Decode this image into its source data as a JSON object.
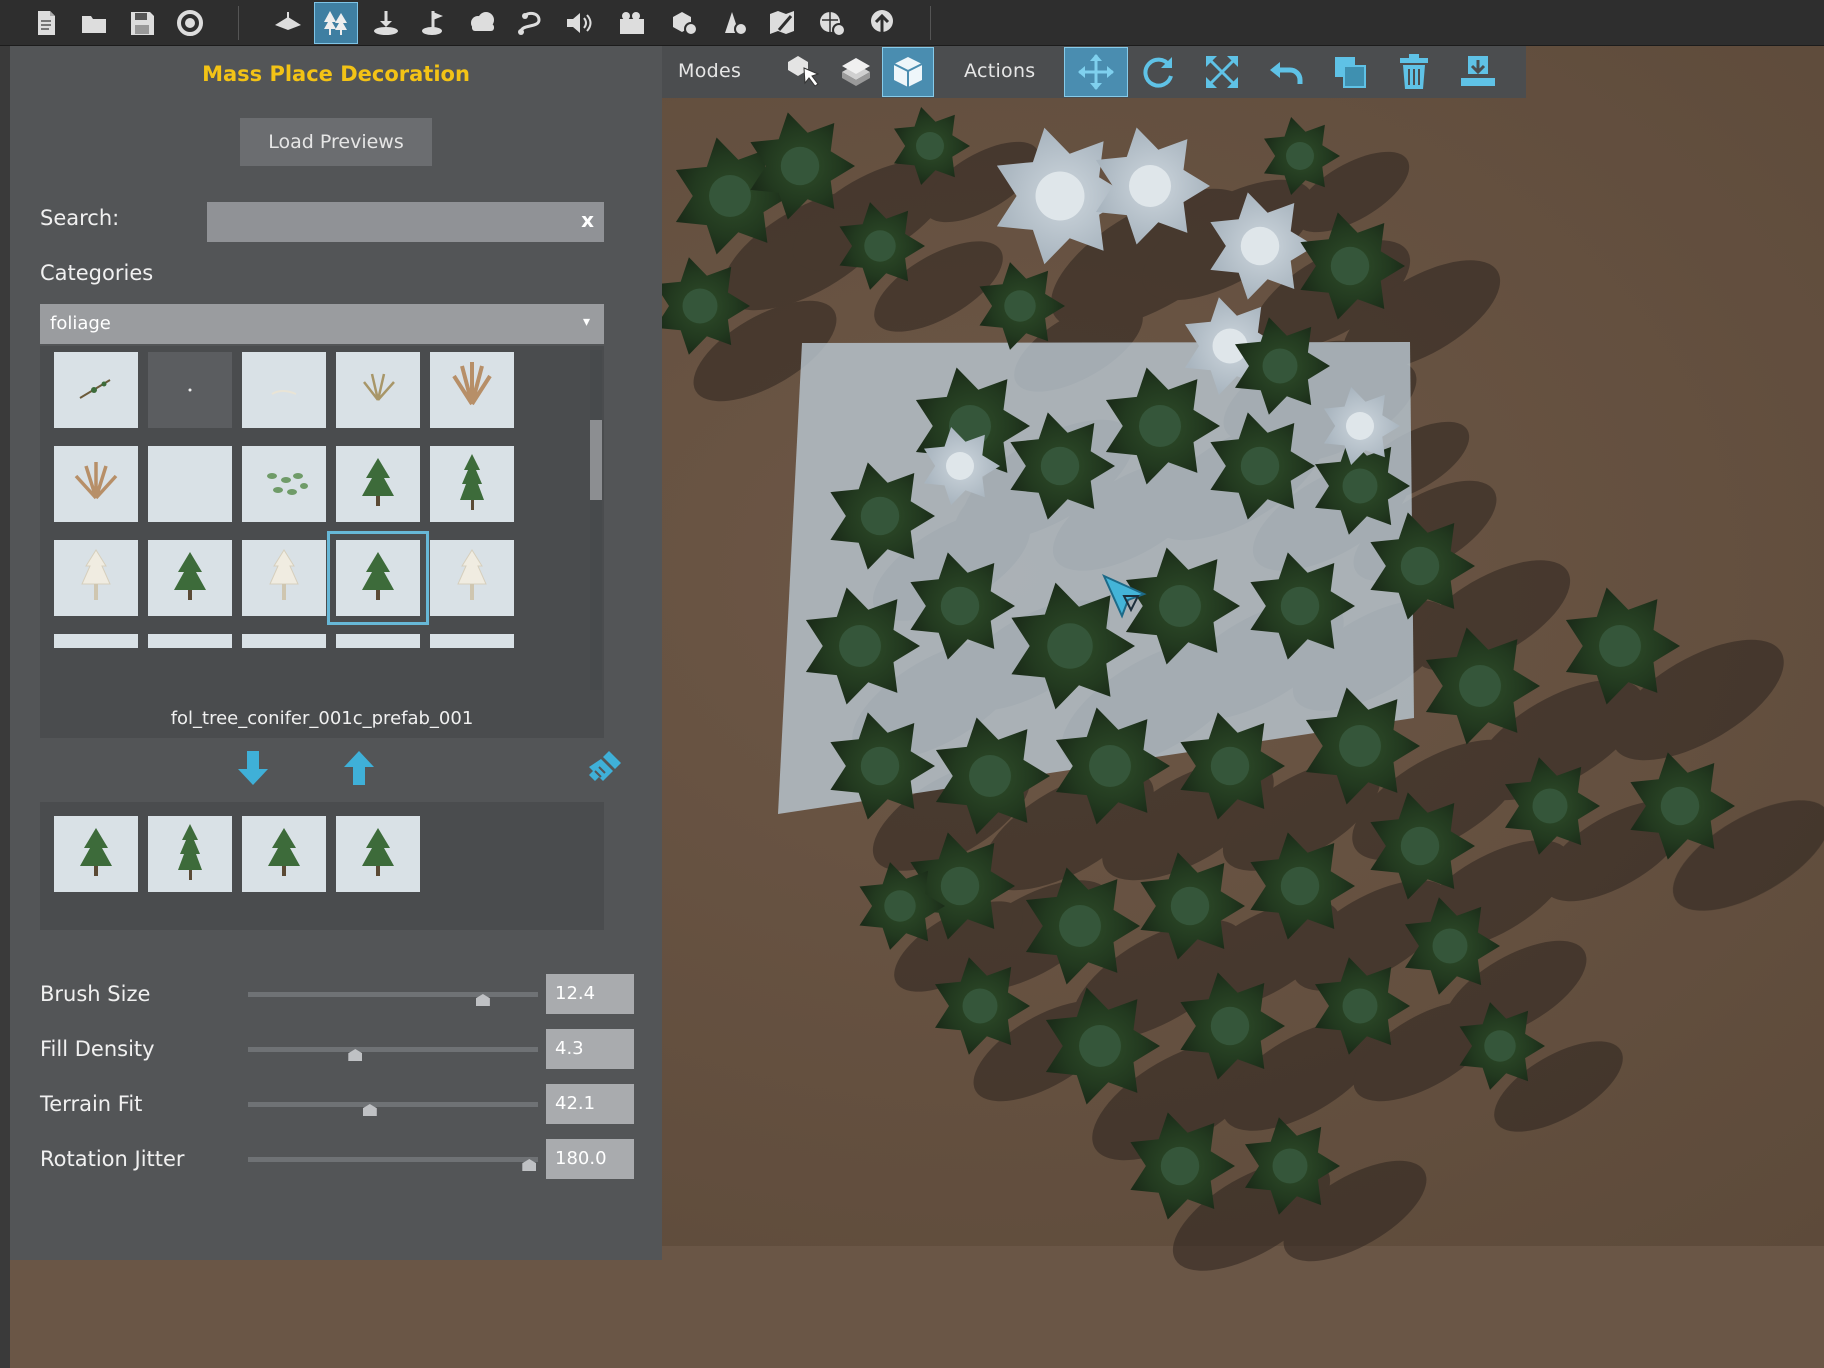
{
  "toolbar": {
    "tools": [
      {
        "name": "new-file-icon",
        "active": false
      },
      {
        "name": "open-folder-icon",
        "active": false
      },
      {
        "name": "save-icon",
        "active": false
      },
      {
        "name": "refresh-icon",
        "active": false
      },
      {
        "name": "terrain-icon",
        "active": false
      },
      {
        "name": "forest-icon",
        "active": true
      },
      {
        "name": "object-place-icon",
        "active": false
      },
      {
        "name": "road-icon",
        "active": false
      },
      {
        "name": "cloud-icon",
        "active": false
      },
      {
        "name": "spline-icon",
        "active": false
      },
      {
        "name": "sound-icon",
        "active": false
      },
      {
        "name": "camera-icon",
        "active": false
      },
      {
        "name": "settings-cube-icon",
        "active": false
      },
      {
        "name": "build-settings-icon",
        "active": false
      },
      {
        "name": "map-edit-icon",
        "active": false
      },
      {
        "name": "world-settings-icon",
        "active": false
      },
      {
        "name": "upload-icon",
        "active": false
      }
    ]
  },
  "mode_bar": {
    "modes_label": "Modes",
    "actions_label": "Actions",
    "modes": [
      {
        "name": "select-mode-icon",
        "active": false
      },
      {
        "name": "paint-mode-icon",
        "active": false
      },
      {
        "name": "mass-place-mode-icon",
        "active": true
      }
    ],
    "actions": [
      {
        "name": "move-icon",
        "active": true
      },
      {
        "name": "rotate-icon",
        "active": false
      },
      {
        "name": "scale-icon",
        "active": false
      },
      {
        "name": "undo-icon",
        "active": false
      },
      {
        "name": "duplicate-icon",
        "active": false
      },
      {
        "name": "delete-icon",
        "active": false
      },
      {
        "name": "snap-to-ground-icon",
        "active": false
      }
    ]
  },
  "panel": {
    "title": "Mass Place Decoration",
    "load_previews": "Load Previews",
    "search_label": "Search:",
    "search_value": "",
    "search_clear": "x",
    "categories_label": "Categories",
    "category_selected": "foliage",
    "category_caret": "▾",
    "selected_prefab": "fol_tree_conifer_001c_prefab_001",
    "grid_tiles": [
      "twig",
      "dot",
      "grass-faint",
      "grass-tuft",
      "fern",
      "dry-grass",
      "blank",
      "clover",
      "conifer",
      "tall-conifer",
      "pale-tree",
      "conifer",
      "pale-tree",
      "conifer",
      "pale-tree",
      "partial",
      "partial",
      "partial",
      "partial",
      "partial"
    ],
    "selected_tile_index": 13,
    "selected_items": [
      "conifer",
      "tall-conifer",
      "conifer",
      "conifer"
    ],
    "sliders": [
      {
        "label": "Brush Size",
        "value": "12.4",
        "fraction": 0.81
      },
      {
        "label": "Fill Density",
        "value": "4.3",
        "fraction": 0.37
      },
      {
        "label": "Terrain Fit",
        "value": "42.1",
        "fraction": 0.42
      },
      {
        "label": "Rotation Jitter",
        "value": "180.0",
        "fraction": 0.97
      }
    ]
  },
  "colors": {
    "accent": "#4fb3d8",
    "title": "#f3c316",
    "panel_bg": "#535557"
  }
}
